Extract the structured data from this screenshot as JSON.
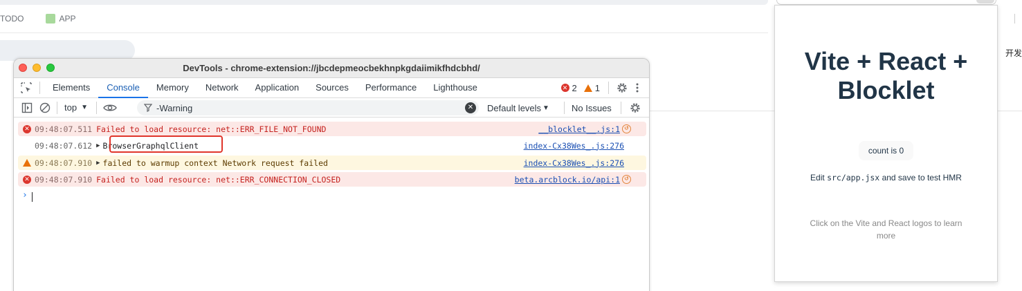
{
  "bookmarks": [
    {
      "label": "TODO"
    },
    {
      "label": "APP"
    }
  ],
  "right_edge_text": "开发",
  "devtools": {
    "title": "DevTools - chrome-extension://jbcdepmeocbekhnpkgdaiimikfhdcbhd/",
    "tabs": [
      "Elements",
      "Console",
      "Memory",
      "Network",
      "Application",
      "Sources",
      "Performance",
      "Lighthouse"
    ],
    "active_tab": "Console",
    "error_count": "2",
    "warning_count": "1",
    "toolbar": {
      "context": "top",
      "filter_value": "-Warning",
      "levels": "Default levels",
      "issues": "No Issues"
    },
    "messages": [
      {
        "level": "error",
        "time": "09:48:07.511",
        "text": "Failed to load resource: net::ERR_FILE_NOT_FOUND",
        "source": "__blocklet__.js:1"
      },
      {
        "level": "info",
        "time": "09:48:07.612",
        "text": "BrowserGraphqlClient",
        "source": "index-Cx38Wes_.js:276"
      },
      {
        "level": "warning",
        "time": "09:48:07.910",
        "text": "failed to warmup context Network request failed",
        "source": "index-Cx38Wes_.js:276"
      },
      {
        "level": "error",
        "time": "09:48:07.910",
        "text": "Failed to load resource: net::ERR_CONNECTION_CLOSED",
        "source": "beta.arcblock.io/api:1"
      }
    ],
    "prompt": "›"
  },
  "popup": {
    "title": "Vite + React + Blocklet",
    "count_label": "count is 0",
    "edit_prefix": "Edit ",
    "edit_code": "src/app.jsx",
    "edit_suffix": " and save to test HMR",
    "hint": "Click on the Vite and React logos to learn more"
  },
  "colors": {
    "error": "#dc362e",
    "warning": "#e8710a",
    "link": "#1a4fb3",
    "accent": "#1a73e8",
    "highlight": "#e0352b"
  }
}
